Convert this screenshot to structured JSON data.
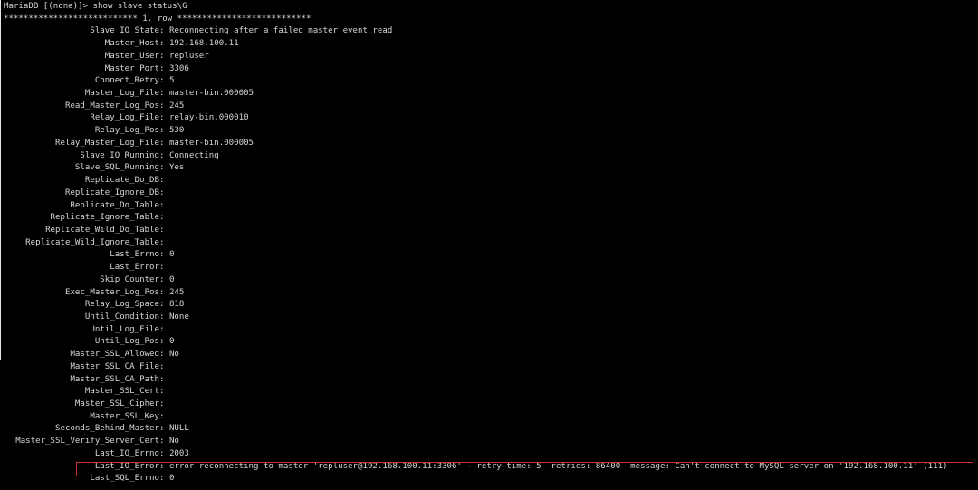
{
  "terminal": {
    "prompt_line": "MariaDB [(none)]> show slave status\\G",
    "row_header": "*************************** 1. row ***************************",
    "fields": [
      {
        "key": "Slave_IO_State",
        "value": "Reconnecting after a failed master event read"
      },
      {
        "key": "Master_Host",
        "value": "192.168.100.11"
      },
      {
        "key": "Master_User",
        "value": "repluser"
      },
      {
        "key": "Master_Port",
        "value": "3306"
      },
      {
        "key": "Connect_Retry",
        "value": "5"
      },
      {
        "key": "Master_Log_File",
        "value": "master-bin.000005"
      },
      {
        "key": "Read_Master_Log_Pos",
        "value": "245"
      },
      {
        "key": "Relay_Log_File",
        "value": "relay-bin.000010"
      },
      {
        "key": "Relay_Log_Pos",
        "value": "530"
      },
      {
        "key": "Relay_Master_Log_File",
        "value": "master-bin.000005"
      },
      {
        "key": "Slave_IO_Running",
        "value": "Connecting"
      },
      {
        "key": "Slave_SQL_Running",
        "value": "Yes"
      },
      {
        "key": "Replicate_Do_DB",
        "value": ""
      },
      {
        "key": "Replicate_Ignore_DB",
        "value": ""
      },
      {
        "key": "Replicate_Do_Table",
        "value": ""
      },
      {
        "key": "Replicate_Ignore_Table",
        "value": ""
      },
      {
        "key": "Replicate_Wild_Do_Table",
        "value": ""
      },
      {
        "key": "Replicate_Wild_Ignore_Table",
        "value": ""
      },
      {
        "key": "Last_Errno",
        "value": "0"
      },
      {
        "key": "Last_Error",
        "value": ""
      },
      {
        "key": "Skip_Counter",
        "value": "0"
      },
      {
        "key": "Exec_Master_Log_Pos",
        "value": "245"
      },
      {
        "key": "Relay_Log_Space",
        "value": "818"
      },
      {
        "key": "Until_Condition",
        "value": "None"
      },
      {
        "key": "Until_Log_File",
        "value": ""
      },
      {
        "key": "Until_Log_Pos",
        "value": "0"
      },
      {
        "key": "Master_SSL_Allowed",
        "value": "No"
      },
      {
        "key": "Master_SSL_CA_File",
        "value": ""
      },
      {
        "key": "Master_SSL_CA_Path",
        "value": ""
      },
      {
        "key": "Master_SSL_Cert",
        "value": ""
      },
      {
        "key": "Master_SSL_Cipher",
        "value": ""
      },
      {
        "key": "Master_SSL_Key",
        "value": ""
      },
      {
        "key": "Seconds_Behind_Master",
        "value": "NULL"
      },
      {
        "key": "Master_SSL_Verify_Server_Cert",
        "value": "No"
      },
      {
        "key": "Last_IO_Errno",
        "value": "2003"
      },
      {
        "key": "Last_IO_Error",
        "value": "error reconnecting to master 'repluser@192.168.100.11:3306' - retry-time: 5  retries: 86400  message: Can't connect to MySQL server on '192.168.100.11' (111)"
      },
      {
        "key": "Last_SQL_Errno",
        "value": "0"
      }
    ],
    "colors": {
      "background": "#000000",
      "text": "#d6d6d6",
      "highlight_border": "#d23030"
    }
  }
}
